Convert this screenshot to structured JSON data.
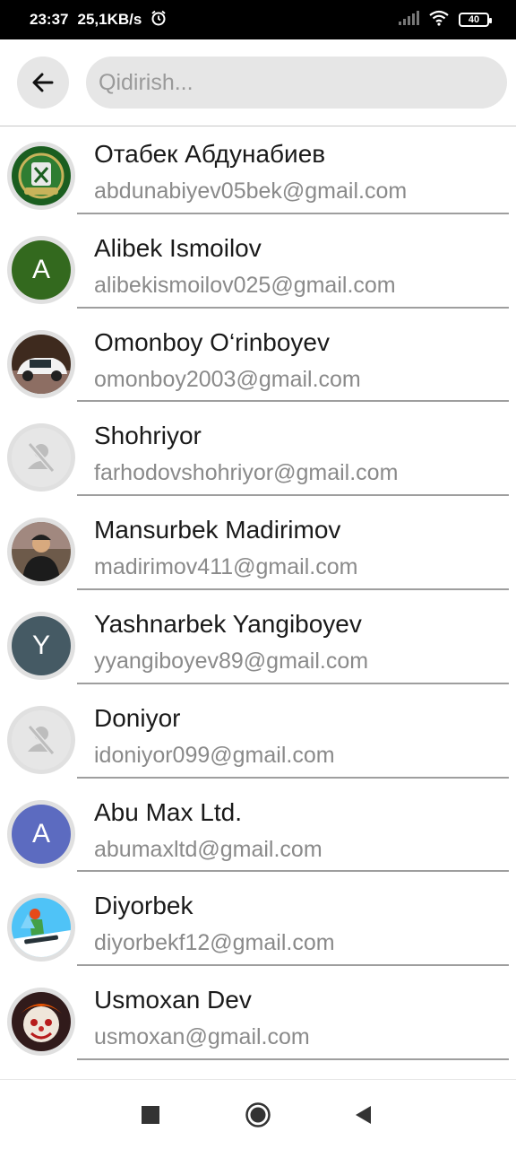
{
  "status": {
    "time": "23:37",
    "speed": "25,1KB/s",
    "battery": "40",
    "icons": [
      "alarm-icon",
      "signal-icon",
      "wifi-icon",
      "battery-icon"
    ]
  },
  "search": {
    "placeholder": "Qidirish..."
  },
  "contacts": [
    {
      "name": "Отабек Абдунабиев",
      "email": "abdunabiyev05bek@gmail.com",
      "avatar": "photo-emblem"
    },
    {
      "name": "Alibek Ismoilov",
      "email": "alibekismoilov025@gmail.com",
      "avatar_letter": "A",
      "avatar_color": "#33691e"
    },
    {
      "name": "Omonboy O‘rinboyev",
      "email": "omonboy2003@gmail.com",
      "avatar": "photo-car"
    },
    {
      "name": "Shohriyor",
      "email": "farhodovshohriyor@gmail.com",
      "avatar": "no-photo"
    },
    {
      "name": "Mansurbek Madirimov",
      "email": "madirimov411@gmail.com",
      "avatar": "photo-person"
    },
    {
      "name": "Yashnarbek Yangiboyev",
      "email": "yyangiboyev89@gmail.com",
      "avatar_letter": "Y",
      "avatar_color": "#455a64"
    },
    {
      "name": "Doniyor",
      "email": "idoniyor099@gmail.com",
      "avatar": "no-photo"
    },
    {
      "name": "Abu Max Ltd.",
      "email": "abumaxltd@gmail.com",
      "avatar_letter": "A",
      "avatar_color": "#5c6bc0"
    },
    {
      "name": "Diyorbek",
      "email": "diyorbekf12@gmail.com",
      "avatar": "photo-snowboard"
    },
    {
      "name": "Usmoxan Dev",
      "email": "usmoxan@gmail.com",
      "avatar": "photo-clown"
    }
  ],
  "colors": {
    "background": "#ffffff",
    "search_bg": "#e6e6e6",
    "name_text": "#1a1a1a",
    "email_text": "#8a8a8a"
  }
}
